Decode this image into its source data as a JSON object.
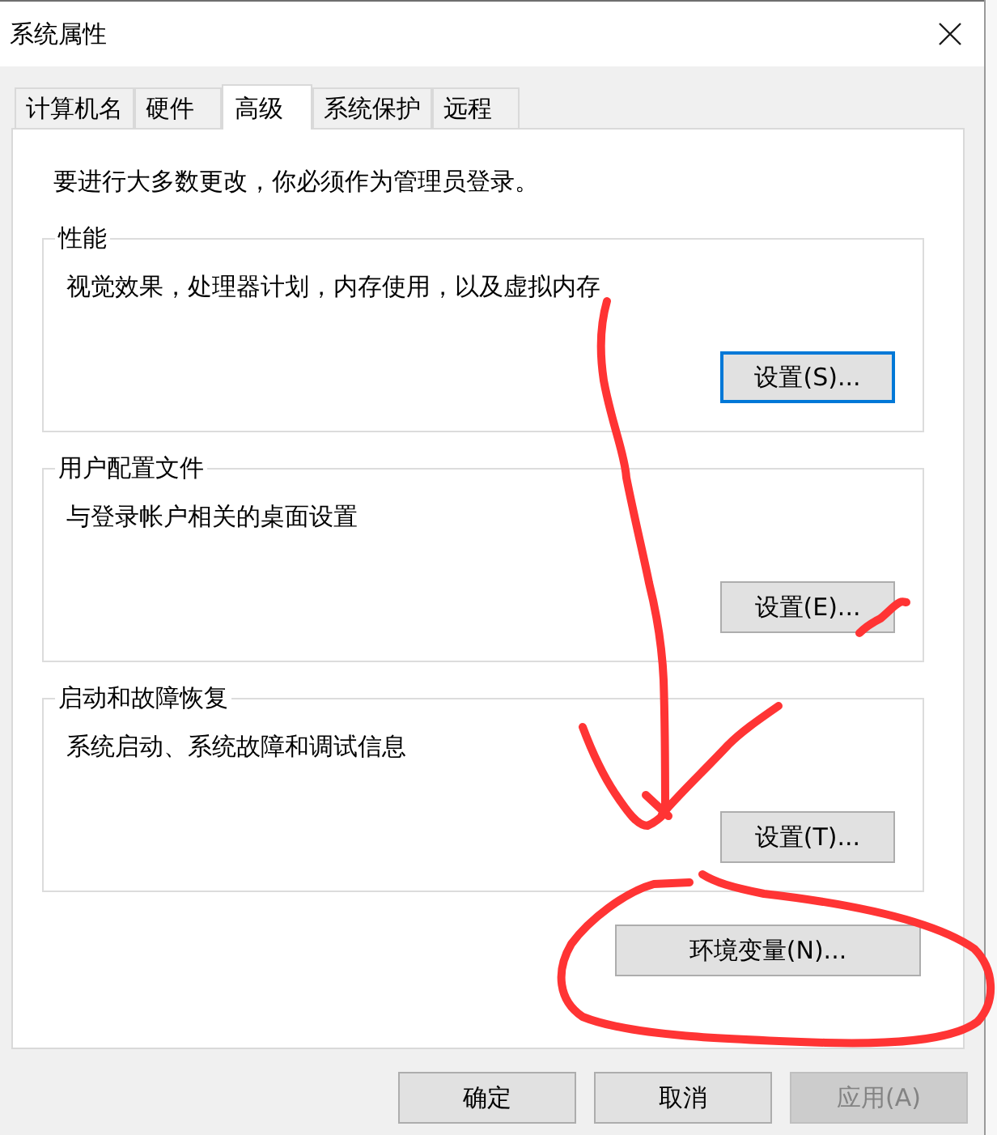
{
  "window": {
    "title": "系统属性"
  },
  "tabs": [
    {
      "label": "计算机名",
      "selected": false
    },
    {
      "label": "硬件",
      "selected": false
    },
    {
      "label": "高级",
      "selected": true
    },
    {
      "label": "系统保护",
      "selected": false
    },
    {
      "label": "远程",
      "selected": false
    }
  ],
  "notice": "要进行大多数更改，你必须作为管理员登录。",
  "groups": [
    {
      "title": "性能",
      "description": "视觉效果，处理器计划，内存使用，以及虚拟内存",
      "button": {
        "label": "设置(S)...",
        "focused": true
      }
    },
    {
      "title": "用户配置文件",
      "description": "与登录帐户相关的桌面设置",
      "button": {
        "label": "设置(E)...",
        "focused": false
      }
    },
    {
      "title": "启动和故障恢复",
      "description": "系统启动、系统故障和调试信息",
      "button": {
        "label": "设置(T)...",
        "focused": false
      }
    }
  ],
  "environment_variables_button": {
    "label": "环境变量(N)..."
  },
  "buttons": [
    {
      "label": "确定",
      "disabled": false
    },
    {
      "label": "取消",
      "disabled": false
    },
    {
      "label": "应用(A)",
      "disabled": true
    }
  ]
}
